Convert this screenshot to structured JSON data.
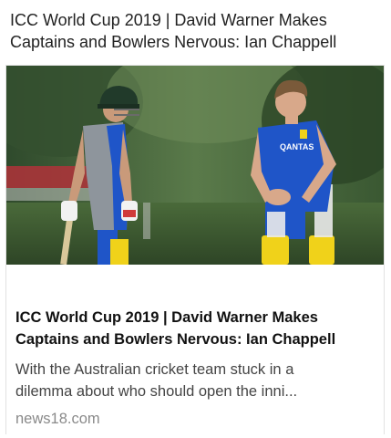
{
  "feed": {
    "headline": "ICC World Cup 2019 | David Warner Makes Captains and Bowlers Nervous: Ian Chappell"
  },
  "card": {
    "image": {
      "description_icon": "photo-two-cricketers",
      "shirt_logo": "QANTAS",
      "colors": {
        "shirt_blue": "#1f55c8",
        "shirt_grey": "#8e959c",
        "pads_yellow": "#f0d21a",
        "background_green": "#3d5a36"
      }
    },
    "title": "ICC World Cup 2019 | David Warner Makes Captains and Bowlers Nervous: Ian Chappell",
    "description": "With the Australian cricket team stuck in a dilemma about who should open the inni...",
    "source": "news18.com"
  }
}
